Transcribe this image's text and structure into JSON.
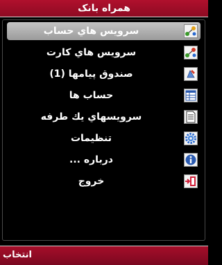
{
  "header": {
    "title": "همراه بانک"
  },
  "menu": {
    "items": [
      {
        "label": "سرويس هاي حساب",
        "icon": "account-services-icon",
        "selected": true
      },
      {
        "label": "سرويس هاي كارت",
        "icon": "card-services-icon",
        "selected": false
      },
      {
        "label": "صندوق پيامها (1)",
        "icon": "inbox-icon",
        "selected": false
      },
      {
        "label": "حساب ها",
        "icon": "accounts-icon",
        "selected": false
      },
      {
        "label": "سرويسهاي يك طرفه",
        "icon": "one-way-services-icon",
        "selected": false
      },
      {
        "label": "تنظيمات",
        "icon": "settings-icon",
        "selected": false
      },
      {
        "label": "درباره ...",
        "icon": "about-icon",
        "selected": false
      },
      {
        "label": "خروج",
        "icon": "exit-icon",
        "selected": false
      }
    ]
  },
  "softkeys": {
    "left": "انتخاب"
  },
  "colors": {
    "title_bar": "#9c0c26",
    "selection": "#b3b3b3",
    "background": "#000000"
  }
}
